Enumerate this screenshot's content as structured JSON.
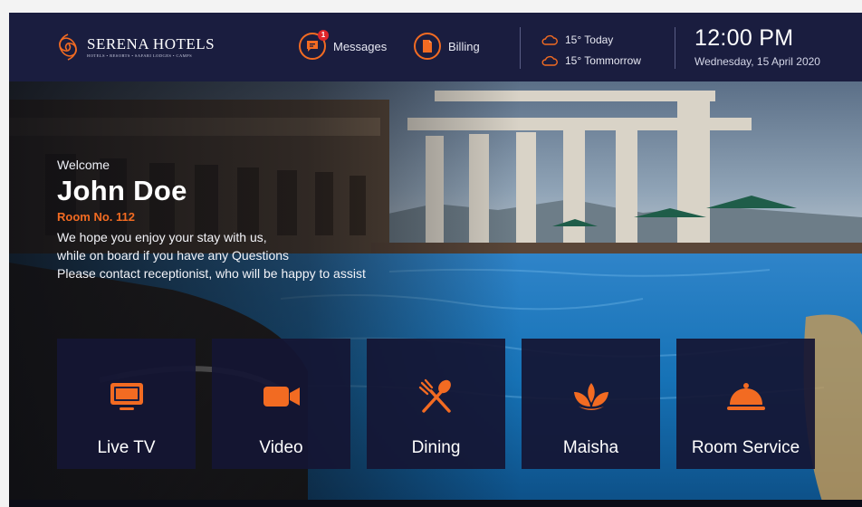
{
  "brand": {
    "name": "SERENA HOTELS",
    "tagline": "HOTELS • RESORTS • SAFARI LODGES • CAMPS",
    "accent_color": "#f26b22",
    "bar_color": "#1a1d3f"
  },
  "header": {
    "messages": {
      "label": "Messages",
      "badge": "1",
      "icon": "chat-icon"
    },
    "billing": {
      "label": "Billing",
      "icon": "document-icon"
    },
    "weather": [
      {
        "text": "15° Today",
        "icon": "cloud-icon"
      },
      {
        "text": "15° Tommorrow",
        "icon": "cloud-icon"
      }
    ],
    "time": "12:00 PM",
    "date": "Wednesday, 15 April 2020"
  },
  "welcome": {
    "label": "Welcome",
    "guest_name": "John Doe",
    "room": "Room No. 112",
    "message": [
      "We hope you enjoy your stay with us,",
      "while on board if you have any Questions",
      "Please contact receptionist, who will be happy to assist"
    ]
  },
  "tiles": [
    {
      "label": "Live TV",
      "icon": "tv-icon"
    },
    {
      "label": "Video",
      "icon": "video-camera-icon"
    },
    {
      "label": "Dining",
      "icon": "fork-spoon-icon"
    },
    {
      "label": "Maisha",
      "icon": "lotus-icon"
    },
    {
      "label": "Room Service",
      "icon": "cloche-icon"
    }
  ]
}
